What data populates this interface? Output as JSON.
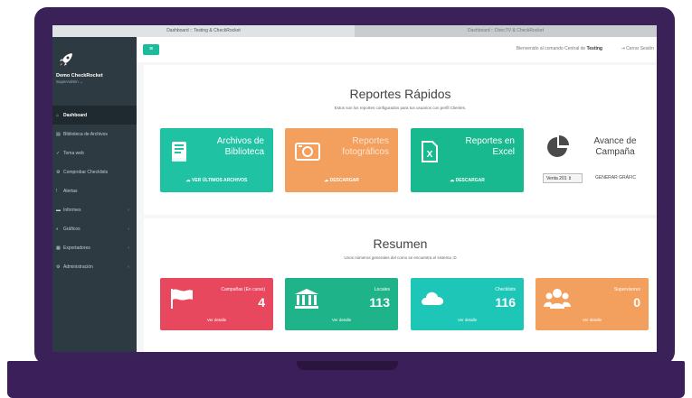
{
  "browser": {
    "tabs": [
      {
        "label": "Dashboard :: Testing & CheckRocket",
        "active": true
      },
      {
        "label": "Dashboard :: DirecTV & CheckRocket",
        "active": false
      }
    ]
  },
  "sidebar": {
    "brand_name": "Demo CheckRocket",
    "brand_role": "SuperAdmin ⌄",
    "items": [
      {
        "label": "Dashboard",
        "icon": "home-icon",
        "glyph": "⌂",
        "active": true,
        "has_chevron": false
      },
      {
        "label": "Biblioteca de Archivos",
        "icon": "book-icon",
        "glyph": "▤",
        "active": false,
        "has_chevron": false
      },
      {
        "label": "Toma web",
        "icon": "check-icon",
        "glyph": "✓",
        "active": false,
        "has_chevron": false
      },
      {
        "label": "Comprobar Checklists",
        "icon": "gear-icon",
        "glyph": "⚙",
        "active": false,
        "has_chevron": false
      },
      {
        "label": "Alertas",
        "icon": "alert-icon",
        "glyph": "!",
        "active": false,
        "has_chevron": false
      },
      {
        "label": "Informes",
        "icon": "report-icon",
        "glyph": "▬",
        "active": false,
        "has_chevron": true
      },
      {
        "label": "Gráficos",
        "icon": "chart-icon",
        "glyph": "◐",
        "active": false,
        "has_chevron": true
      },
      {
        "label": "Exportadores",
        "icon": "export-icon",
        "glyph": "▦",
        "active": false,
        "has_chevron": true
      },
      {
        "label": "Administración",
        "icon": "admin-icon",
        "glyph": "⚙",
        "active": false,
        "has_chevron": true
      }
    ]
  },
  "topbar": {
    "menu_icon": "menu-icon",
    "welcome_prefix": "Bienvenido al comando Central de",
    "welcome_name": "Testing",
    "logout_label": "Cerrar Sesión"
  },
  "reportes": {
    "title": "Reportes Rápidos",
    "subtitle": "Estos son los reportes configurados para tus usuarios con perfil Clientes.",
    "cards": [
      {
        "title": "Archivos de Biblioteca",
        "action": "☁ VER ÚLTIMOS ARCHIVOS",
        "icon": "book-icon",
        "color": "#1fc3a4"
      },
      {
        "title": "Reportes fotográficos",
        "action": "☁ DESCARGAR",
        "icon": "camera-icon",
        "color": "#f3a05f"
      },
      {
        "title": "Reportes en Excel",
        "action": "☁ DESCARGAR",
        "icon": "excel-icon",
        "color": "#18b98f"
      }
    ],
    "avance": {
      "title": "Avance de Campaña",
      "select_value": "Venta 201 ⇕",
      "button_label": "GENERAR GRÁFIC",
      "icon": "pie-chart-icon"
    }
  },
  "resumen": {
    "title": "Resumen",
    "subtitle": "Unos números generales del como se encuentra el sistema :D",
    "cards": [
      {
        "label": "Campañas (En curso)",
        "value": "4",
        "link": "Ver detalle",
        "icon": "flag-icon",
        "color": "#e7485e"
      },
      {
        "label": "Locales",
        "value": "113",
        "link": "Ver detalle",
        "icon": "bank-icon",
        "color": "#1fb38a"
      },
      {
        "label": "Checklists",
        "value": "116",
        "link": "Ver detalle",
        "icon": "cloud-icon",
        "color": "#1ec6b8"
      },
      {
        "label": "Supervisores",
        "value": "0",
        "link": "Ver detalle",
        "icon": "users-icon",
        "color": "#f3a05f"
      }
    ]
  }
}
